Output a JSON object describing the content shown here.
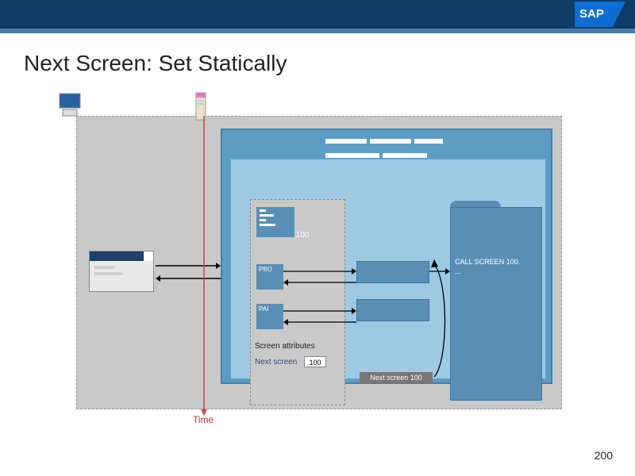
{
  "header": {
    "brand": "SAP"
  },
  "title": "Next Screen: Set Statically",
  "page_number": "200",
  "time_label": "Time",
  "screen": {
    "number": "100",
    "pbo_label": "PBO",
    "pai_label": "PAI",
    "attributes_label": "Screen attributes",
    "next_screen_label": "Next screen",
    "next_screen_value": "100"
  },
  "code": {
    "call_text": "CALL SCREEN 100.",
    "ellipsis": "..."
  },
  "next_badge": "Next screen 100"
}
